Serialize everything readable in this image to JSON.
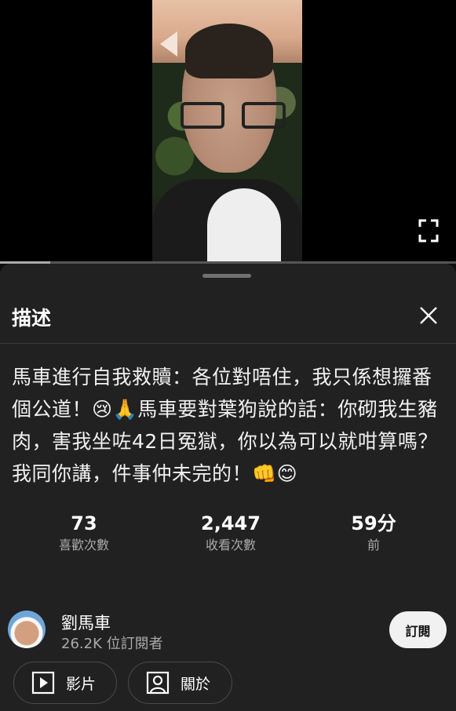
{
  "video": {
    "progress": 0.11
  },
  "panel": {
    "title": "描述",
    "description": "馬車進行自我救贖：各位對唔住，我只係想攞番個公道！😢🙏馬車要對葉狗說的話：你砌我生豬肉，害我坐咗42日冤獄，你以為可以就咁算嗎？我同你講，件事仲未完的！👊😊"
  },
  "stats": [
    {
      "value": "73",
      "label": "喜歡次數"
    },
    {
      "value": "2,447",
      "label": "收看次數"
    },
    {
      "value": "59分",
      "label": "前"
    }
  ],
  "channel": {
    "name": "劉馬車",
    "subscribers": "26.2K 位訂閱者",
    "subscribe_label": "訂閱"
  },
  "chips": [
    {
      "label": "影片",
      "icon": "play-box-icon"
    },
    {
      "label": "關於",
      "icon": "person-box-icon"
    }
  ],
  "colors": {
    "background": "#0f0f0f",
    "panel": "#212121",
    "subscribe_bg": "#f1f1f1"
  }
}
